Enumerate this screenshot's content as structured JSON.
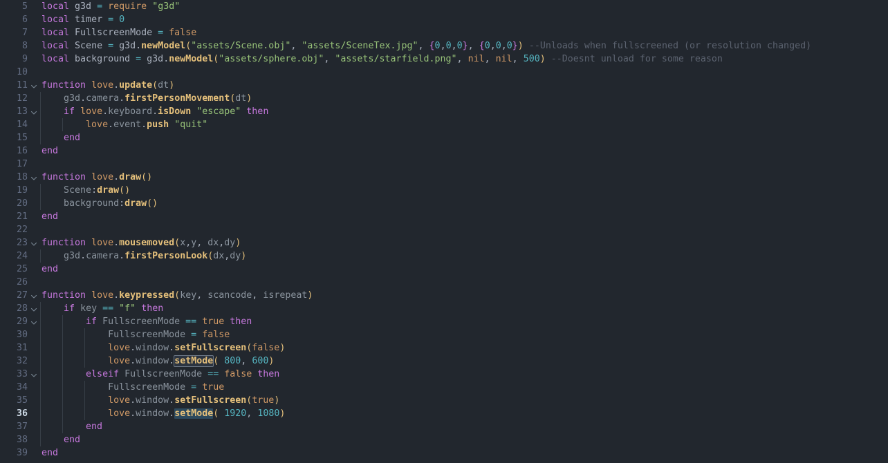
{
  "editor": {
    "name": "code-editor",
    "language": "lua",
    "theme": {
      "background": "#22272e",
      "gutter_text": "#636d83",
      "active_line_number": "#cdd9e5",
      "indent_guide": "#373e47",
      "keyword": "#c678dd",
      "function_name": "#e5c07b",
      "identifier": "#abb2bf",
      "string": "#98c379",
      "number": "#56b6c2",
      "comment": "#5c6370",
      "variable": "#d19a66",
      "selection": "#2d4a5e",
      "occurrence_outline": "#6b7785"
    },
    "cursor_line": 36,
    "selected_word": "setMode",
    "first_visible_line": 5,
    "last_visible_line": 39
  },
  "lines": [
    {
      "num": "5",
      "fold": "",
      "guides": 0,
      "text": "local g3d = require \"g3d\""
    },
    {
      "num": "6",
      "fold": "",
      "guides": 0,
      "text": "local timer = 0"
    },
    {
      "num": "7",
      "fold": "",
      "guides": 0,
      "text": "local FullscreenMode = false"
    },
    {
      "num": "8",
      "fold": "",
      "guides": 0,
      "text": "local Scene = g3d.newModel(\"assets/Scene.obj\", \"assets/SceneTex.jpg\", {0,0,0}, {0,0,0}) --Unloads when fullscreened (or resolution changed)"
    },
    {
      "num": "9",
      "fold": "",
      "guides": 0,
      "text": "local background = g3d.newModel(\"assets/sphere.obj\", \"assets/starfield.png\", nil, nil, 500) --Doesnt unload for some reason"
    },
    {
      "num": "10",
      "fold": "",
      "guides": 0,
      "text": ""
    },
    {
      "num": "11",
      "fold": "down",
      "guides": 0,
      "text": "function love.update(dt)"
    },
    {
      "num": "12",
      "fold": "",
      "guides": 1,
      "text": "    g3d.camera.firstPersonMovement(dt)"
    },
    {
      "num": "13",
      "fold": "down",
      "guides": 1,
      "text": "    if love.keyboard.isDown \"escape\" then"
    },
    {
      "num": "14",
      "fold": "",
      "guides": 2,
      "text": "        love.event.push \"quit\""
    },
    {
      "num": "15",
      "fold": "",
      "guides": 1,
      "text": "    end"
    },
    {
      "num": "16",
      "fold": "",
      "guides": 0,
      "text": "end"
    },
    {
      "num": "17",
      "fold": "",
      "guides": 0,
      "text": ""
    },
    {
      "num": "18",
      "fold": "down",
      "guides": 0,
      "text": "function love.draw()"
    },
    {
      "num": "19",
      "fold": "",
      "guides": 1,
      "text": "    Scene:draw()"
    },
    {
      "num": "20",
      "fold": "",
      "guides": 1,
      "text": "    background:draw()"
    },
    {
      "num": "21",
      "fold": "",
      "guides": 0,
      "text": "end"
    },
    {
      "num": "22",
      "fold": "",
      "guides": 0,
      "text": ""
    },
    {
      "num": "23",
      "fold": "down",
      "guides": 0,
      "text": "function love.mousemoved(x,y, dx,dy)"
    },
    {
      "num": "24",
      "fold": "",
      "guides": 1,
      "text": "    g3d.camera.firstPersonLook(dx,dy)"
    },
    {
      "num": "25",
      "fold": "",
      "guides": 0,
      "text": "end"
    },
    {
      "num": "26",
      "fold": "",
      "guides": 0,
      "text": ""
    },
    {
      "num": "27",
      "fold": "down",
      "guides": 0,
      "text": "function love.keypressed(key, scancode, isrepeat)"
    },
    {
      "num": "28",
      "fold": "down",
      "guides": 1,
      "text": "    if key == \"f\" then"
    },
    {
      "num": "29",
      "fold": "down",
      "guides": 2,
      "text": "        if FullscreenMode == true then"
    },
    {
      "num": "30",
      "fold": "",
      "guides": 3,
      "text": "            FullscreenMode = false"
    },
    {
      "num": "31",
      "fold": "",
      "guides": 3,
      "text": "            love.window.setFullscreen(false)"
    },
    {
      "num": "32",
      "fold": "",
      "guides": 3,
      "text": "            love.window.setMode( 800, 600)"
    },
    {
      "num": "33",
      "fold": "down",
      "guides": 2,
      "text": "        elseif FullscreenMode == false then"
    },
    {
      "num": "34",
      "fold": "",
      "guides": 3,
      "text": "            FullscreenMode = true"
    },
    {
      "num": "35",
      "fold": "",
      "guides": 3,
      "text": "            love.window.setFullscreen(true)"
    },
    {
      "num": "36",
      "fold": "",
      "guides": 3,
      "text": "            love.window.setMode( 1920, 1080)"
    },
    {
      "num": "37",
      "fold": "",
      "guides": 2,
      "text": "        end"
    },
    {
      "num": "38",
      "fold": "",
      "guides": 1,
      "text": "    end"
    },
    {
      "num": "39",
      "fold": "",
      "guides": 0,
      "text": "end"
    }
  ],
  "tokens": {
    "l5": [
      [
        "kw",
        "local"
      ],
      [
        "sp",
        " "
      ],
      [
        "ident",
        "g3d"
      ],
      [
        "sp",
        " "
      ],
      [
        "op",
        "="
      ],
      [
        "sp",
        " "
      ],
      [
        "var",
        "require"
      ],
      [
        "sp",
        " "
      ],
      [
        "str",
        "\"g3d\""
      ]
    ],
    "l6": [
      [
        "kw",
        "local"
      ],
      [
        "sp",
        " "
      ],
      [
        "ident",
        "timer"
      ],
      [
        "sp",
        " "
      ],
      [
        "op",
        "="
      ],
      [
        "sp",
        " "
      ],
      [
        "num",
        "0"
      ]
    ],
    "l7": [
      [
        "kw",
        "local"
      ],
      [
        "sp",
        " "
      ],
      [
        "ident",
        "FullscreenMode"
      ],
      [
        "sp",
        " "
      ],
      [
        "op",
        "="
      ],
      [
        "sp",
        " "
      ],
      [
        "var",
        "false"
      ]
    ],
    "l8": [
      [
        "kw",
        "local"
      ],
      [
        "sp",
        " "
      ],
      [
        "ident",
        "Scene"
      ],
      [
        "sp",
        " "
      ],
      [
        "op",
        "="
      ],
      [
        "sp",
        " "
      ],
      [
        "ident",
        "g3d"
      ],
      [
        "punc",
        "."
      ],
      [
        "fnname",
        "newModel"
      ],
      [
        "p1",
        "("
      ],
      [
        "str",
        "\"assets/Scene.obj\""
      ],
      [
        "punc",
        ","
      ],
      [
        "sp",
        " "
      ],
      [
        "str",
        "\"assets/SceneTex.jpg\""
      ],
      [
        "punc",
        ","
      ],
      [
        "sp",
        " "
      ],
      [
        "p2",
        "{"
      ],
      [
        "num",
        "0"
      ],
      [
        "punc",
        ","
      ],
      [
        "num",
        "0"
      ],
      [
        "punc",
        ","
      ],
      [
        "num",
        "0"
      ],
      [
        "p2",
        "}"
      ],
      [
        "punc",
        ","
      ],
      [
        "sp",
        " "
      ],
      [
        "p2",
        "{"
      ],
      [
        "num",
        "0"
      ],
      [
        "punc",
        ","
      ],
      [
        "num",
        "0"
      ],
      [
        "punc",
        ","
      ],
      [
        "num",
        "0"
      ],
      [
        "p2",
        "}"
      ],
      [
        "p1",
        ")"
      ],
      [
        "sp",
        " "
      ],
      [
        "cmt",
        "--Unloads when fullscreened (or resolution changed)"
      ]
    ],
    "l9": [
      [
        "kw",
        "local"
      ],
      [
        "sp",
        " "
      ],
      [
        "ident",
        "background"
      ],
      [
        "sp",
        " "
      ],
      [
        "op",
        "="
      ],
      [
        "sp",
        " "
      ],
      [
        "ident",
        "g3d"
      ],
      [
        "punc",
        "."
      ],
      [
        "fnname",
        "newModel"
      ],
      [
        "p1",
        "("
      ],
      [
        "str",
        "\"assets/sphere.obj\""
      ],
      [
        "punc",
        ","
      ],
      [
        "sp",
        " "
      ],
      [
        "str",
        "\"assets/starfield.png\""
      ],
      [
        "punc",
        ","
      ],
      [
        "sp",
        " "
      ],
      [
        "var",
        "nil"
      ],
      [
        "punc",
        ","
      ],
      [
        "sp",
        " "
      ],
      [
        "var",
        "nil"
      ],
      [
        "punc",
        ","
      ],
      [
        "sp",
        " "
      ],
      [
        "num",
        "500"
      ],
      [
        "p1",
        ")"
      ],
      [
        "sp",
        " "
      ],
      [
        "cmt",
        "--Doesnt unload for some reason"
      ]
    ],
    "l11": [
      [
        "kw",
        "function"
      ],
      [
        "sp",
        " "
      ],
      [
        "var",
        "love"
      ],
      [
        "punc",
        "."
      ],
      [
        "fnname",
        "update"
      ],
      [
        "p1",
        "("
      ],
      [
        "id2",
        "dt"
      ],
      [
        "p1",
        ")"
      ]
    ],
    "l12": [
      [
        "sp",
        "    "
      ],
      [
        "id2",
        "g3d"
      ],
      [
        "punc",
        "."
      ],
      [
        "id2",
        "camera"
      ],
      [
        "punc",
        "."
      ],
      [
        "fnname",
        "firstPersonMovement"
      ],
      [
        "p1",
        "("
      ],
      [
        "id2",
        "dt"
      ],
      [
        "p1",
        ")"
      ]
    ],
    "l13": [
      [
        "sp",
        "    "
      ],
      [
        "kw",
        "if"
      ],
      [
        "sp",
        " "
      ],
      [
        "var",
        "love"
      ],
      [
        "punc",
        "."
      ],
      [
        "id2",
        "keyboard"
      ],
      [
        "punc",
        "."
      ],
      [
        "fnname",
        "isDown"
      ],
      [
        "sp",
        " "
      ],
      [
        "str",
        "\"escape\""
      ],
      [
        "sp",
        " "
      ],
      [
        "kw",
        "then"
      ]
    ],
    "l14": [
      [
        "sp",
        "        "
      ],
      [
        "var",
        "love"
      ],
      [
        "punc",
        "."
      ],
      [
        "id2",
        "event"
      ],
      [
        "punc",
        "."
      ],
      [
        "fnname",
        "push"
      ],
      [
        "sp",
        " "
      ],
      [
        "str",
        "\"quit\""
      ]
    ],
    "l15": [
      [
        "sp",
        "    "
      ],
      [
        "kw",
        "end"
      ]
    ],
    "l16": [
      [
        "kw",
        "end"
      ]
    ],
    "l18": [
      [
        "kw",
        "function"
      ],
      [
        "sp",
        " "
      ],
      [
        "var",
        "love"
      ],
      [
        "punc",
        "."
      ],
      [
        "fnname",
        "draw"
      ],
      [
        "p1",
        "("
      ],
      [
        "p1",
        ")"
      ]
    ],
    "l19": [
      [
        "sp",
        "    "
      ],
      [
        "id2",
        "Scene"
      ],
      [
        "punc",
        ":"
      ],
      [
        "fnname",
        "draw"
      ],
      [
        "p1",
        "("
      ],
      [
        "p1",
        ")"
      ]
    ],
    "l20": [
      [
        "sp",
        "    "
      ],
      [
        "id2",
        "background"
      ],
      [
        "punc",
        ":"
      ],
      [
        "fnname",
        "draw"
      ],
      [
        "p1",
        "("
      ],
      [
        "p1",
        ")"
      ]
    ],
    "l21": [
      [
        "kw",
        "end"
      ]
    ],
    "l23": [
      [
        "kw",
        "function"
      ],
      [
        "sp",
        " "
      ],
      [
        "var",
        "love"
      ],
      [
        "punc",
        "."
      ],
      [
        "fnname",
        "mousemoved"
      ],
      [
        "p1",
        "("
      ],
      [
        "id2",
        "x"
      ],
      [
        "punc",
        ","
      ],
      [
        "id2",
        "y"
      ],
      [
        "punc",
        ","
      ],
      [
        "sp",
        " "
      ],
      [
        "id2",
        "dx"
      ],
      [
        "punc",
        ","
      ],
      [
        "id2",
        "dy"
      ],
      [
        "p1",
        ")"
      ]
    ],
    "l24": [
      [
        "sp",
        "    "
      ],
      [
        "id2",
        "g3d"
      ],
      [
        "punc",
        "."
      ],
      [
        "id2",
        "camera"
      ],
      [
        "punc",
        "."
      ],
      [
        "fnname",
        "firstPersonLook"
      ],
      [
        "p1",
        "("
      ],
      [
        "id2",
        "dx"
      ],
      [
        "punc",
        ","
      ],
      [
        "id2",
        "dy"
      ],
      [
        "p1",
        ")"
      ]
    ],
    "l25": [
      [
        "kw",
        "end"
      ]
    ],
    "l27": [
      [
        "kw",
        "function"
      ],
      [
        "sp",
        " "
      ],
      [
        "var",
        "love"
      ],
      [
        "punc",
        "."
      ],
      [
        "fnname",
        "keypressed"
      ],
      [
        "p1",
        "("
      ],
      [
        "id2",
        "key"
      ],
      [
        "punc",
        ","
      ],
      [
        "sp",
        " "
      ],
      [
        "id2",
        "scancode"
      ],
      [
        "punc",
        ","
      ],
      [
        "sp",
        " "
      ],
      [
        "id2",
        "isrepeat"
      ],
      [
        "p1",
        ")"
      ]
    ],
    "l28": [
      [
        "sp",
        "    "
      ],
      [
        "kw",
        "if"
      ],
      [
        "sp",
        " "
      ],
      [
        "id2",
        "key"
      ],
      [
        "sp",
        " "
      ],
      [
        "op",
        "=="
      ],
      [
        "sp",
        " "
      ],
      [
        "str",
        "\"f\""
      ],
      [
        "sp",
        " "
      ],
      [
        "kw",
        "then"
      ]
    ],
    "l29": [
      [
        "sp",
        "        "
      ],
      [
        "kw",
        "if"
      ],
      [
        "sp",
        " "
      ],
      [
        "id2",
        "FullscreenMode"
      ],
      [
        "sp",
        " "
      ],
      [
        "op",
        "=="
      ],
      [
        "sp",
        " "
      ],
      [
        "var",
        "true"
      ],
      [
        "sp",
        " "
      ],
      [
        "kw",
        "then"
      ]
    ],
    "l30": [
      [
        "sp",
        "            "
      ],
      [
        "id2",
        "FullscreenMode"
      ],
      [
        "sp",
        " "
      ],
      [
        "op",
        "="
      ],
      [
        "sp",
        " "
      ],
      [
        "var",
        "false"
      ]
    ],
    "l31": [
      [
        "sp",
        "            "
      ],
      [
        "var",
        "love"
      ],
      [
        "punc",
        "."
      ],
      [
        "id2",
        "window"
      ],
      [
        "punc",
        "."
      ],
      [
        "fnname",
        "setFullscreen"
      ],
      [
        "p1",
        "("
      ],
      [
        "var",
        "false"
      ],
      [
        "p1",
        ")"
      ]
    ],
    "l32": [
      [
        "sp",
        "            "
      ],
      [
        "var",
        "love"
      ],
      [
        "punc",
        "."
      ],
      [
        "id2",
        "window"
      ],
      [
        "punc",
        "."
      ],
      [
        "occ",
        "setMode"
      ],
      [
        "p1",
        "("
      ],
      [
        "sp",
        " "
      ],
      [
        "num",
        "800"
      ],
      [
        "punc",
        ","
      ],
      [
        "sp",
        " "
      ],
      [
        "num",
        "600"
      ],
      [
        "p1",
        ")"
      ]
    ],
    "l33": [
      [
        "sp",
        "        "
      ],
      [
        "kw",
        "elseif"
      ],
      [
        "sp",
        " "
      ],
      [
        "id2",
        "FullscreenMode"
      ],
      [
        "sp",
        " "
      ],
      [
        "op",
        "=="
      ],
      [
        "sp",
        " "
      ],
      [
        "var",
        "false"
      ],
      [
        "sp",
        " "
      ],
      [
        "kw",
        "then"
      ]
    ],
    "l34": [
      [
        "sp",
        "            "
      ],
      [
        "id2",
        "FullscreenMode"
      ],
      [
        "sp",
        " "
      ],
      [
        "op",
        "="
      ],
      [
        "sp",
        " "
      ],
      [
        "var",
        "true"
      ]
    ],
    "l35": [
      [
        "sp",
        "            "
      ],
      [
        "var",
        "love"
      ],
      [
        "punc",
        "."
      ],
      [
        "id2",
        "window"
      ],
      [
        "punc",
        "."
      ],
      [
        "fnname",
        "setFullscreen"
      ],
      [
        "p1",
        "("
      ],
      [
        "var",
        "true"
      ],
      [
        "p1",
        ")"
      ]
    ],
    "l36": [
      [
        "sp",
        "            "
      ],
      [
        "var",
        "love"
      ],
      [
        "punc",
        "."
      ],
      [
        "id2",
        "window"
      ],
      [
        "punc",
        "."
      ],
      [
        "sel",
        "setMode"
      ],
      [
        "p1",
        "("
      ],
      [
        "sp",
        " "
      ],
      [
        "num",
        "1920"
      ],
      [
        "punc",
        ","
      ],
      [
        "sp",
        " "
      ],
      [
        "num",
        "1080"
      ],
      [
        "p1",
        ")"
      ]
    ],
    "l37": [
      [
        "sp",
        "        "
      ],
      [
        "kw",
        "end"
      ]
    ],
    "l38": [
      [
        "sp",
        "    "
      ],
      [
        "kw",
        "end"
      ]
    ],
    "l39": [
      [
        "kw",
        "end"
      ]
    ]
  }
}
